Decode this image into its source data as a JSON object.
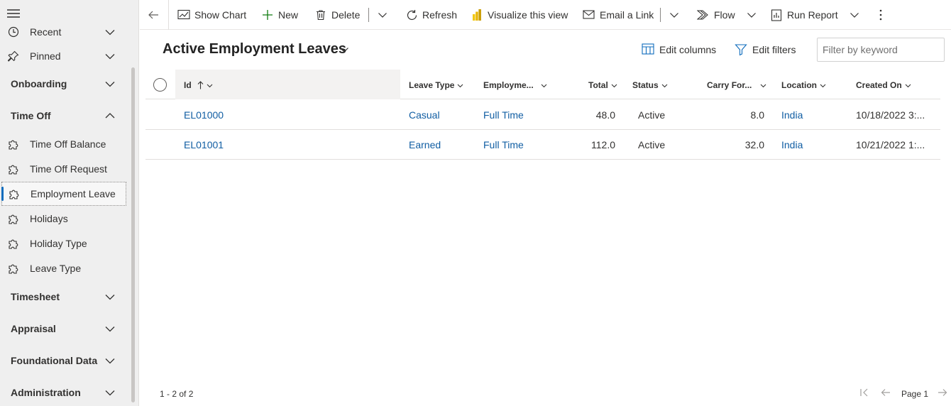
{
  "sidebar": {
    "menu_icon": "hamburger-icon",
    "recent_label": "Recent",
    "pinned_label": "Pinned",
    "groups": {
      "onboarding": "Onboarding",
      "time_off": "Time Off",
      "timesheet": "Timesheet",
      "appraisal": "Appraisal",
      "foundational": "Foundational Data",
      "administration": "Administration"
    },
    "time_off_items": [
      {
        "label": "Time Off Balance",
        "icon": "puzzle-icon"
      },
      {
        "label": "Time Off Request",
        "icon": "puzzle-icon"
      },
      {
        "label": "Employment Leave",
        "icon": "puzzle-icon",
        "selected": true
      },
      {
        "label": "Holidays",
        "icon": "puzzle-icon"
      },
      {
        "label": "Holiday Type",
        "icon": "puzzle-icon"
      },
      {
        "label": "Leave Type",
        "icon": "puzzle-icon"
      }
    ]
  },
  "toolbar": {
    "back_icon": "back-arrow-icon",
    "show_chart": "Show Chart",
    "new": "New",
    "delete": "Delete",
    "refresh": "Refresh",
    "visualize": "Visualize this view",
    "email_link": "Email a Link",
    "flow": "Flow",
    "run_report": "Run Report",
    "more_icon": "more-vertical-icon"
  },
  "view": {
    "title": "Active Employment Leaves",
    "edit_columns": "Edit columns",
    "edit_filters": "Edit filters",
    "filter_placeholder": "Filter by keyword",
    "filter_value": ""
  },
  "grid": {
    "columns": [
      "Id",
      "Leave Type",
      "Employme...",
      "Total",
      "Status",
      "Carry For...",
      "Location",
      "Created On"
    ],
    "sort": {
      "column": "Id",
      "direction": "ascending"
    },
    "rows": [
      {
        "id": "EL01000",
        "leave_type": "Casual",
        "employment": "Full Time",
        "total": "48.0",
        "status": "Active",
        "carry_forward": "8.0",
        "location": "India",
        "created_on": "10/18/2022 3:..."
      },
      {
        "id": "EL01001",
        "leave_type": "Earned",
        "employment": "Full Time",
        "total": "112.0",
        "status": "Active",
        "carry_forward": "32.0",
        "location": "India",
        "created_on": "10/21/2022 1:..."
      }
    ]
  },
  "footer": {
    "record_count": "1 - 2 of 2",
    "page_label": "Page 1"
  },
  "colors": {
    "accent": "#0f6cbd",
    "link": "#115ea3",
    "sidebar_bg": "#efefef"
  }
}
